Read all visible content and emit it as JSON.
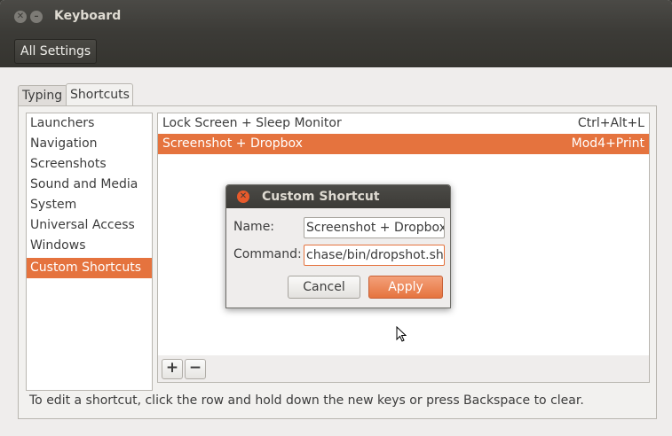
{
  "window": {
    "title": "Keyboard",
    "close_glyph": "✕",
    "minimize_glyph": "–"
  },
  "toolbar": {
    "all_settings_label": "All Settings"
  },
  "tabs": [
    {
      "label": "Typing",
      "selected": false
    },
    {
      "label": "Shortcuts",
      "selected": true
    }
  ],
  "categories": [
    {
      "label": "Launchers"
    },
    {
      "label": "Navigation"
    },
    {
      "label": "Screenshots"
    },
    {
      "label": "Sound and Media"
    },
    {
      "label": "System"
    },
    {
      "label": "Universal Access"
    },
    {
      "label": "Windows"
    },
    {
      "label": "Custom Shortcuts",
      "selected": true
    }
  ],
  "shortcuts": [
    {
      "name": "Lock Screen + Sleep Monitor",
      "accel": "Ctrl+Alt+L",
      "selected": false
    },
    {
      "name": "Screenshot + Dropbox",
      "accel": "Mod4+Print",
      "selected": true
    }
  ],
  "list_toolbar": {
    "add_glyph": "+",
    "remove_glyph": "−"
  },
  "hint": "To edit a shortcut, click the row and hold down the new keys or press Backspace to clear.",
  "dialog": {
    "title": "Custom Shortcut",
    "close_glyph": "✕",
    "name_label": "Name:",
    "name_value": "Screenshot + Dropbox",
    "command_label": "Command:",
    "command_value": "chase/bin/dropshot.sh",
    "cancel_label": "Cancel",
    "apply_label": "Apply"
  },
  "colors": {
    "accent": "#e5733e",
    "titlebar": "#3c3b37",
    "window_bg": "#efedec"
  },
  "icons": {
    "window_close": "close-icon",
    "window_minimize": "minimize-icon",
    "dialog_close": "close-icon",
    "cursor": "mouse-pointer-icon"
  }
}
